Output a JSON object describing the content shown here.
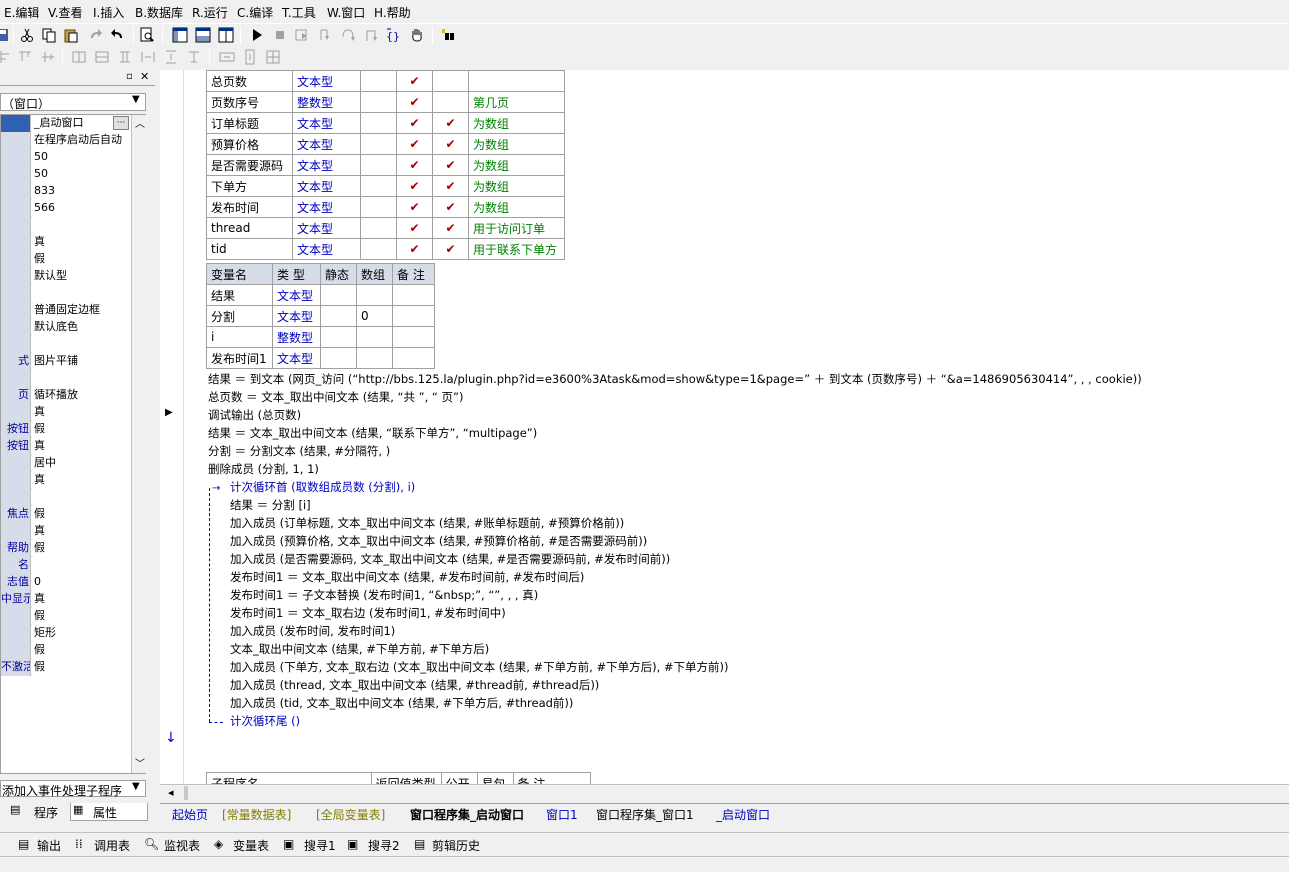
{
  "menu": [
    "E.编辑",
    "V.查看",
    "I.插入",
    "B.数据库",
    "R.运行",
    "C.编译",
    "T.工具",
    "W.窗口",
    "H.帮助"
  ],
  "left_panel": {
    "combo_value": "（窗口）",
    "rows": [
      {
        "k": "",
        "v": "_启动窗口"
      },
      {
        "k": "",
        "v": "在程序启动后自动"
      },
      {
        "k": "",
        "v": "50"
      },
      {
        "k": "",
        "v": "50"
      },
      {
        "k": "",
        "v": "833"
      },
      {
        "k": "",
        "v": "566"
      },
      {
        "k": "",
        "v": ""
      },
      {
        "k": "",
        "v": "真"
      },
      {
        "k": "",
        "v": "假"
      },
      {
        "k": "",
        "v": "默认型"
      },
      {
        "k": "",
        "v": ""
      },
      {
        "k": "",
        "v": "普通固定边框"
      },
      {
        "k": "",
        "v": "默认底色"
      },
      {
        "k": "",
        "v": ""
      },
      {
        "k": "式",
        "v": "图片平铺"
      },
      {
        "k": "",
        "v": ""
      },
      {
        "k": "页",
        "v": "循环播放"
      },
      {
        "k": "",
        "v": "真"
      },
      {
        "k": "按钮",
        "v": "假"
      },
      {
        "k": "按钮",
        "v": "真"
      },
      {
        "k": "",
        "v": "居中"
      },
      {
        "k": "",
        "v": "真"
      },
      {
        "k": "",
        "v": ""
      },
      {
        "k": "焦点",
        "v": "假"
      },
      {
        "k": "",
        "v": "真"
      },
      {
        "k": "帮助",
        "v": "假"
      },
      {
        "k": "名",
        "v": ""
      },
      {
        "k": "志值",
        "v": "0"
      },
      {
        "k": "中显示",
        "v": "真"
      },
      {
        "k": "",
        "v": "假"
      },
      {
        "k": "",
        "v": "矩形"
      },
      {
        "k": "",
        "v": "假"
      },
      {
        "k": "不激活",
        "v": "假"
      }
    ],
    "event_combo": "添加入事件处理子程序",
    "tab_program": "程序",
    "tab_property": "属性"
  },
  "assembly_table": [
    [
      "总页数",
      "文本型",
      "",
      "✔",
      "",
      ""
    ],
    [
      "页数序号",
      "整数型",
      "",
      "✔",
      "",
      "第几页"
    ],
    [
      "订单标题",
      "文本型",
      "",
      "✔",
      "✔",
      "为数组"
    ],
    [
      "预算价格",
      "文本型",
      "",
      "✔",
      "✔",
      "为数组"
    ],
    [
      "是否需要源码",
      "文本型",
      "",
      "✔",
      "✔",
      "为数组"
    ],
    [
      "下单方",
      "文本型",
      "",
      "✔",
      "✔",
      "为数组"
    ],
    [
      "发布时间",
      "文本型",
      "",
      "✔",
      "✔",
      "为数组"
    ],
    [
      "thread",
      "文本型",
      "",
      "✔",
      "✔",
      "用于访问订单"
    ],
    [
      "tid",
      "文本型",
      "",
      "✔",
      "✔",
      "用于联系下单方"
    ]
  ],
  "local_table": {
    "headers": [
      "变量名",
      "类 型",
      "静态",
      "数组",
      "备 注"
    ],
    "rows": [
      [
        "结果",
        "文本型",
        "",
        "",
        ""
      ],
      [
        "分割",
        "文本型",
        "",
        "0",
        ""
      ],
      [
        "i",
        "整数型",
        "",
        "",
        ""
      ],
      [
        "发布时间1",
        "文本型",
        "",
        "",
        ""
      ]
    ]
  },
  "code_lines": [
    "结果 ＝ 到文本 (网页_访问 (“http://bbs.125.la/plugin.php?id=e3600%3Atask&mod=show&type=1&page=” ＋ 到文本 (页数序号) ＋ “&a=1486905630414”, , , cookie))",
    "总页数 ＝ 文本_取出中间文本 (结果, “共 ”, “ 页”)",
    "调试输出 (总页数)",
    "结果 ＝ 文本_取出中间文本 (结果, “联系下单方”, “multipage”)",
    "分割 ＝ 分割文本 (结果, #分隔符, )",
    "删除成员 (分割, 1, 1)",
    "计次循环首 (取数组成员数 (分割), i)",
    "结果 ＝ 分割 [i]",
    "加入成员 (订单标题, 文本_取出中间文本 (结果, #账单标题前, #预算价格前))",
    "加入成员 (预算价格, 文本_取出中间文本 (结果, #预算价格前, #是否需要源码前))",
    "加入成员 (是否需要源码, 文本_取出中间文本 (结果, #是否需要源码前, #发布时间前))",
    "发布时间1 ＝ 文本_取出中间文本 (结果, #发布时间前, #发布时间后)",
    "发布时间1 ＝ 子文本替换 (发布时间1, “&nbsp;”, “”, , , 真)",
    "发布时间1 ＝ 文本_取右边 (发布时间1, #发布时间中)",
    "加入成员 (发布时间, 发布时间1)",
    "文本_取出中间文本 (结果, #下单方前, #下单方后)",
    "加入成员 (下单方, 文本_取右边 (文本_取出中间文本 (结果, #下单方前, #下单方后), #下单方前))",
    "加入成员 (thread, 文本_取出中间文本 (结果, #thread前, #thread后))",
    "加入成员 (tid, 文本_取出中间文本 (结果, #下单方后, #thread前))",
    "计次循环尾 ()"
  ],
  "sub_header": [
    "子程序名",
    "返回值类型",
    "公开",
    "易包",
    "备 注"
  ],
  "editor_tabs": [
    "起始页",
    "[常量数据表]",
    "[全局变量表]",
    "窗口程序集_启动窗口",
    "窗口1",
    "窗口程序集_窗口1",
    "_启动窗口"
  ],
  "bottom_tabs": [
    "输出",
    "调用表",
    "监视表",
    "变量表",
    "搜寻1",
    "搜寻2",
    "剪辑历史"
  ]
}
